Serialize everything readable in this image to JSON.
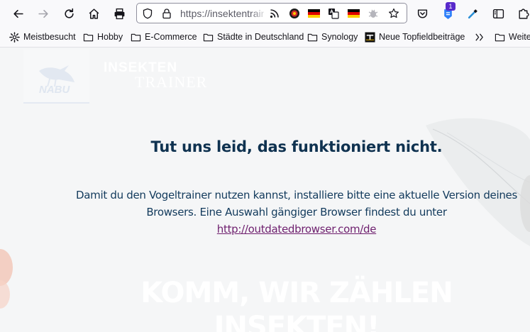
{
  "browser": {
    "url": "https://insektentrainer.nabu.de",
    "extension_badge": "1",
    "nav_icons": [
      "back-arrow-icon",
      "forward-arrow-icon",
      "reload-icon",
      "home-icon",
      "print-icon"
    ],
    "urlbar_icons": [
      "shield-icon",
      "lock-icon",
      "rss-feed-icon",
      "target-icon",
      "german-flag-icon",
      "translate-icon",
      "german-flag-icon",
      "extension-bug-icon",
      "star-icon"
    ],
    "right_icons": [
      "pocket-icon",
      "extension-icon",
      "eyedropper-icon",
      "sidebar-icon",
      "extensions-puzzle-icon"
    ]
  },
  "bookmarks": {
    "items": [
      {
        "label": "Meistbesucht",
        "icon": "gear-icon"
      },
      {
        "label": "Hobby",
        "icon": "folder-icon"
      },
      {
        "label": "E-Commerce",
        "icon": "folder-icon"
      },
      {
        "label": "Städte in Deutschland",
        "icon": "folder-icon"
      },
      {
        "label": "Synology",
        "icon": "folder-icon"
      },
      {
        "label": "Neue Topfieldbeiträge",
        "icon": "topfield-icon"
      },
      {
        "label": "Weite",
        "icon": "folder-icon"
      }
    ],
    "overflow_icon": "double-chevron-icon"
  },
  "page": {
    "logo_text": "NABU",
    "site_title_line1": "INSEKTEN",
    "site_title_line2": "TRAINER",
    "heading": "Tut uns leid, das funktioniert nicht.",
    "message_line1": "Damit du den Vogeltrainer nutzen kannst, installiere bitte eine aktuelle Version deines",
    "message_line2": "Browsers. Eine Auswahl gängiger Browser findest du unter ",
    "link_text": "http://outdatedbrowser.com/de",
    "bg_headline_line1": "KOMM, WIR ZÄHLEN",
    "bg_headline_line2": "INSEKTEN!"
  },
  "colors": {
    "heading": "#0f3250",
    "link": "#6e1f6e",
    "page_background": "#f5f6f7"
  }
}
